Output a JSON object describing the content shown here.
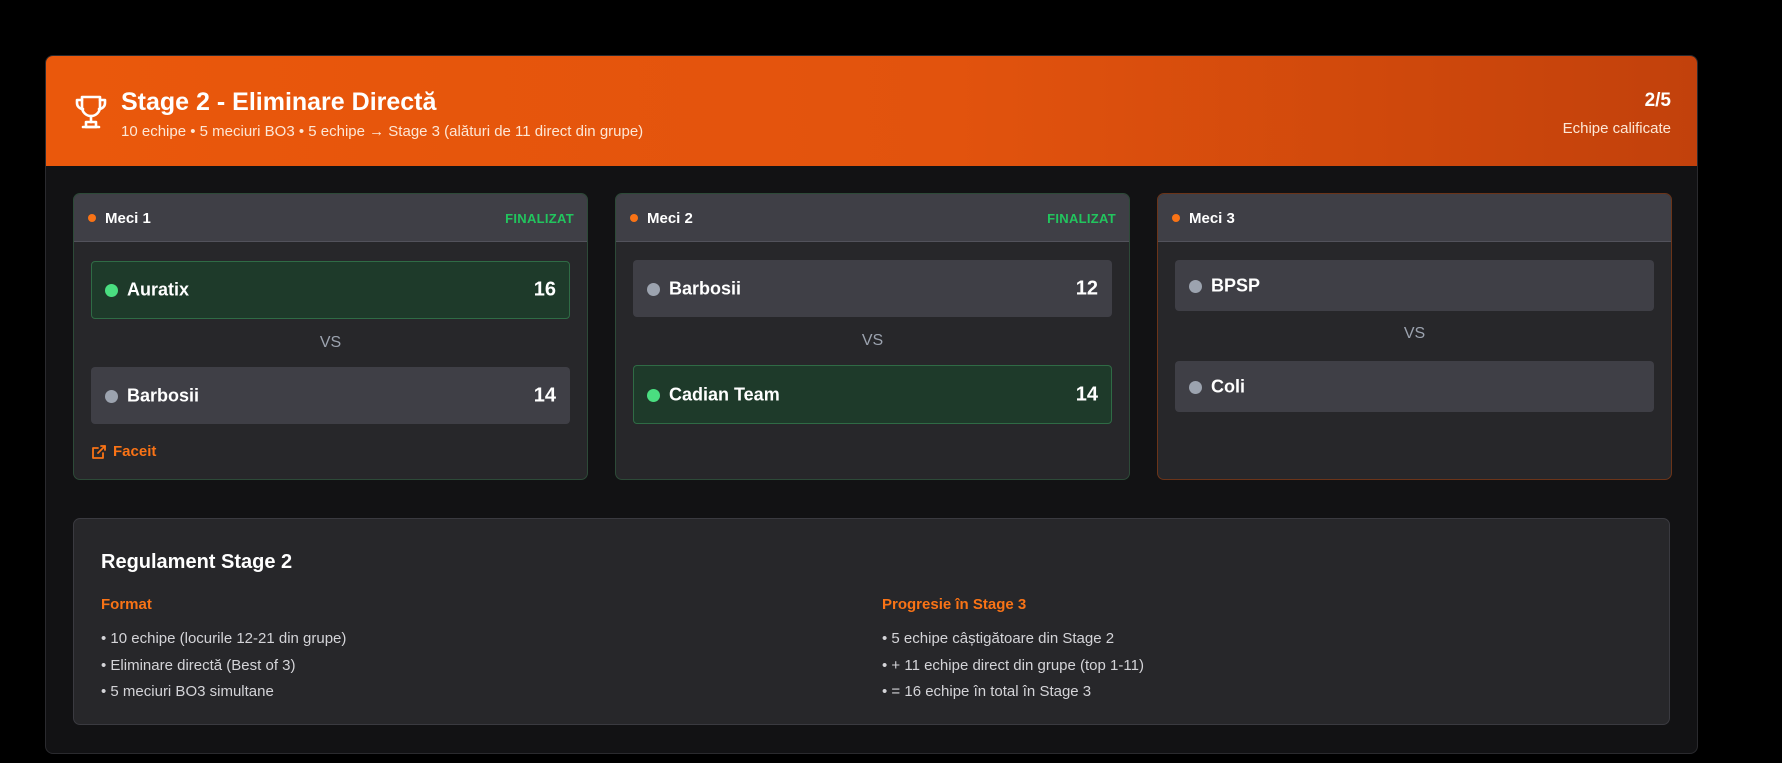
{
  "header": {
    "icon": "trophy-icon",
    "title": "Stage 2 - Eliminare Directă",
    "subtitle": "10 echipe • 5 meciuri BO3 • 5 echipe → Stage 3 (alături de 11 direct din grupe)",
    "qualified_count": "2/5",
    "qualified_label": "Echipe calificate"
  },
  "matches": [
    {
      "name": "Meci 1",
      "status": "FINALIZAT",
      "team1": {
        "name": "Auratix",
        "score": "16",
        "winner": true
      },
      "vs": "VS",
      "team2": {
        "name": "Barbosii",
        "score": "14",
        "winner": false
      },
      "link_label": "Faceit"
    },
    {
      "name": "Meci 2",
      "status": "FINALIZAT",
      "team1": {
        "name": "Barbosii",
        "score": "12",
        "winner": false
      },
      "vs": "VS",
      "team2": {
        "name": "Cadian Team",
        "score": "14",
        "winner": true
      }
    },
    {
      "name": "Meci 3",
      "status": "",
      "team1": {
        "name": "BPSP",
        "score": ""
      },
      "vs": "VS",
      "team2": {
        "name": "Coli",
        "score": ""
      }
    }
  ],
  "rules": {
    "title": "Regulament Stage 2",
    "format": {
      "heading": "Format",
      "items": [
        "• 10 echipe (locurile 12-21 din grupe)",
        "• Eliminare directă (Best of 3)",
        "• 5 meciuri BO3 simultane"
      ]
    },
    "progression": {
      "heading": "Progresie în Stage 3",
      "items": [
        "• 5 echipe câștigătoare din Stage 2",
        "• + 11 echipe direct din grupe (top 1-11)",
        "• = 16 echipe în total în Stage 3"
      ]
    }
  },
  "colors": {
    "accent": "#f97316",
    "header_start": "#ea580c",
    "header_end": "#c2410c",
    "winner": "#4ade80",
    "status_done": "#22c55e"
  }
}
